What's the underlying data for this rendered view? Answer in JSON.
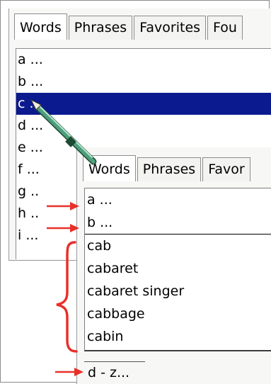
{
  "back_window": {
    "tabs": [
      "Words",
      "Phrases",
      "Favorites",
      "Fou"
    ],
    "rows": [
      "a ...",
      "b ...",
      "c ...",
      "d ...",
      "e ...",
      "f ...",
      "g ..",
      "h ..",
      "i ..."
    ],
    "selected_row": "c ...",
    "selection_color": "#0c1a8f"
  },
  "front_window": {
    "tabs": [
      "Words",
      "Phrases",
      "Favor"
    ],
    "rows": [
      "a ...",
      "b ...",
      "cab",
      "cabaret",
      "cabaret singer",
      "cabbage",
      "cabin"
    ],
    "footer_item": "d - z..."
  },
  "annotations": {
    "arrow_color": "#e8302a",
    "brace_color": "#e8302a",
    "icons": [
      "stylus-icon",
      "arrow-icon",
      "brace-icon"
    ]
  }
}
